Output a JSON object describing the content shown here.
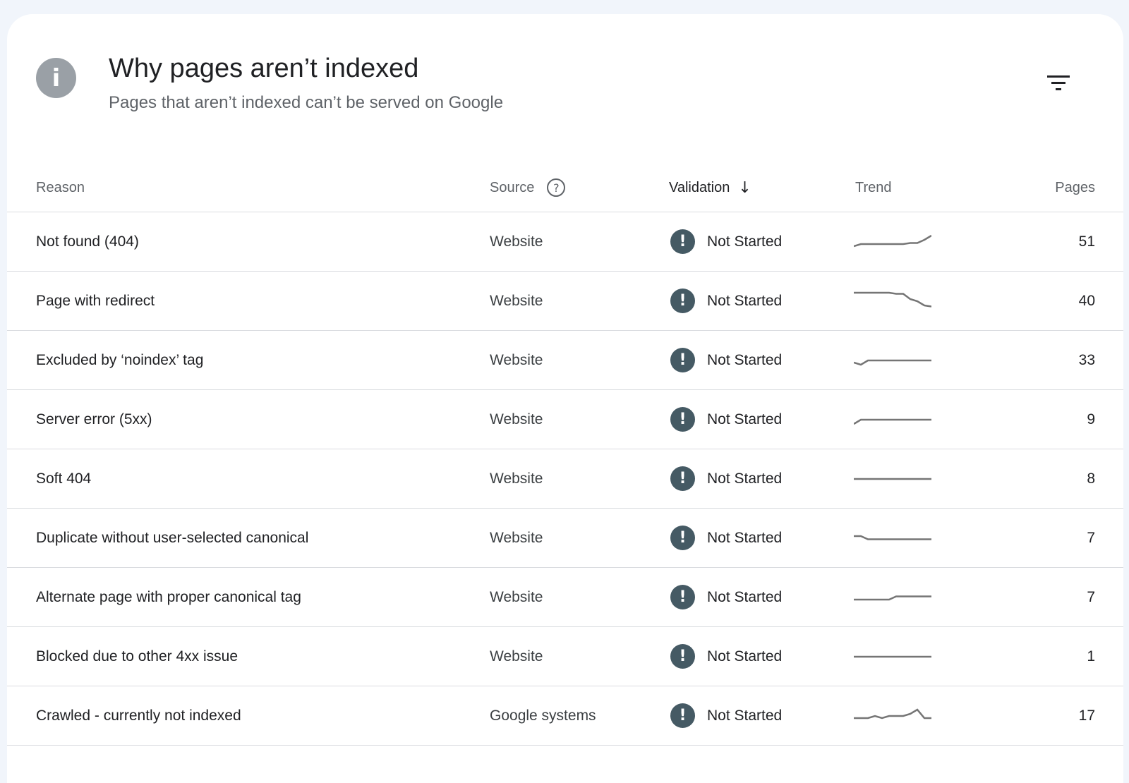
{
  "header": {
    "info_icon": "info-icon",
    "title": "Why pages aren’t indexed",
    "subtitle": "Pages that aren’t indexed can’t be served on Google",
    "filter_icon": "filter-list-icon"
  },
  "table": {
    "columns": {
      "reason": "Reason",
      "source": "Source",
      "validation": "Validation",
      "trend": "Trend",
      "pages": "Pages"
    },
    "sorted_by": "validation",
    "sort_icon": "arrow-down-icon",
    "help_icon": "help-circle-icon",
    "status_icon": "alert-circle-icon",
    "rows": [
      {
        "reason": "Not found (404)",
        "source": "Website",
        "validation": "Not Started",
        "pages": "51",
        "trend": [
          0.3,
          0.4,
          0.4,
          0.4,
          0.4,
          0.4,
          0.4,
          0.4,
          0.45,
          0.45,
          0.6,
          0.8
        ]
      },
      {
        "reason": "Page with redirect",
        "source": "Website",
        "validation": "Not Started",
        "pages": "40",
        "trend": [
          0.9,
          0.9,
          0.9,
          0.9,
          0.9,
          0.9,
          0.85,
          0.85,
          0.6,
          0.5,
          0.3,
          0.25
        ]
      },
      {
        "reason": "Excluded by ‘noindex’ tag",
        "source": "Website",
        "validation": "Not Started",
        "pages": "33",
        "trend": [
          0.4,
          0.3,
          0.5,
          0.5,
          0.5,
          0.5,
          0.5,
          0.5,
          0.5,
          0.5,
          0.5,
          0.5
        ]
      },
      {
        "reason": "Server error (5xx)",
        "source": "Website",
        "validation": "Not Started",
        "pages": "9",
        "trend": [
          0.3,
          0.5,
          0.5,
          0.5,
          0.5,
          0.5,
          0.5,
          0.5,
          0.5,
          0.5,
          0.5,
          0.5
        ]
      },
      {
        "reason": "Soft 404",
        "source": "Website",
        "validation": "Not Started",
        "pages": "8",
        "trend": [
          0.5,
          0.5,
          0.5,
          0.5,
          0.5,
          0.5,
          0.5,
          0.5,
          0.5,
          0.5,
          0.5,
          0.5
        ]
      },
      {
        "reason": "Duplicate without user-selected canonical",
        "source": "Website",
        "validation": "Not Started",
        "pages": "7",
        "trend": [
          0.6,
          0.6,
          0.45,
          0.45,
          0.45,
          0.45,
          0.45,
          0.45,
          0.45,
          0.45,
          0.45,
          0.45
        ]
      },
      {
        "reason": "Alternate page with proper canonical tag",
        "source": "Website",
        "validation": "Not Started",
        "pages": "7",
        "trend": [
          0.4,
          0.4,
          0.4,
          0.4,
          0.4,
          0.4,
          0.55,
          0.55,
          0.55,
          0.55,
          0.55,
          0.55
        ]
      },
      {
        "reason": "Blocked due to other 4xx issue",
        "source": "Website",
        "validation": "Not Started",
        "pages": "1",
        "trend": [
          0.5,
          0.5,
          0.5,
          0.5,
          0.5,
          0.5,
          0.5,
          0.5,
          0.5,
          0.5,
          0.5,
          0.5
        ]
      },
      {
        "reason": "Crawled - currently not indexed",
        "source": "Google systems",
        "validation": "Not Started",
        "pages": "17",
        "trend": [
          0.4,
          0.4,
          0.4,
          0.5,
          0.4,
          0.5,
          0.5,
          0.5,
          0.6,
          0.8,
          0.4,
          0.4
        ]
      }
    ]
  },
  "colors": {
    "page_bg": "#f1f5fb",
    "card_bg": "#ffffff",
    "status_icon": "#455a64",
    "sparkline": "#757575",
    "divider": "#dadce0"
  }
}
